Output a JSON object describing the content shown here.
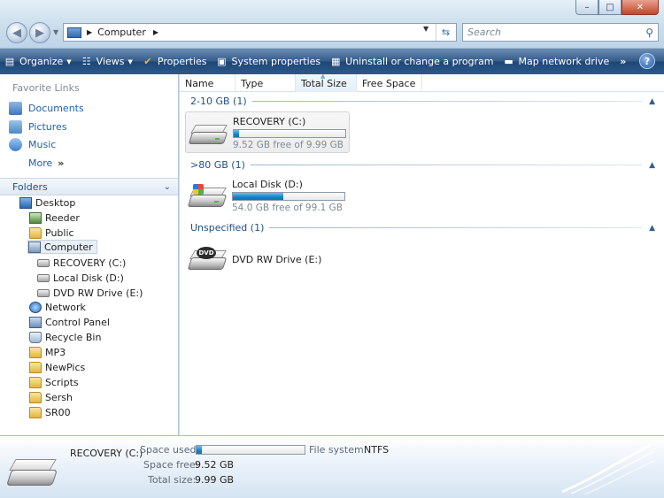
{
  "window": {
    "minimize_glyph": "–",
    "maximize_glyph": "□",
    "close_glyph": "✕"
  },
  "address": {
    "path": "Computer",
    "search_placeholder": "Search"
  },
  "commands": [
    {
      "label": "Organize",
      "icon": "organize-icon",
      "has_caret": true
    },
    {
      "label": "Views",
      "icon": "views-icon",
      "has_caret": true
    },
    {
      "label": "Properties",
      "icon": "checkmark-icon",
      "has_caret": false
    },
    {
      "label": "System properties",
      "icon": "system-properties-icon",
      "has_caret": false
    },
    {
      "label": "Uninstall or change a program",
      "icon": "uninstall-icon",
      "has_caret": false
    },
    {
      "label": "Map network drive",
      "icon": "network-drive-icon",
      "has_caret": false
    }
  ],
  "help_label": "?",
  "nav": {
    "favorites_header": "Favorite Links",
    "favorites": [
      "Documents",
      "Pictures",
      "Music"
    ],
    "more": "More",
    "folders_header": "Folders",
    "tree": [
      {
        "label": "Desktop",
        "icon": "desktop-icon",
        "level": 0
      },
      {
        "label": "Reeder",
        "icon": "user-folder-icon",
        "level": 1
      },
      {
        "label": "Public",
        "icon": "folder-icon",
        "level": 1
      },
      {
        "label": "Computer",
        "icon": "computer-icon",
        "level": 1,
        "selected": true
      },
      {
        "label": "RECOVERY (C:)",
        "icon": "drive-icon",
        "level": 2
      },
      {
        "label": "Local Disk (D:)",
        "icon": "drive-icon",
        "level": 2
      },
      {
        "label": "DVD RW Drive (E:)",
        "icon": "dvd-drive-icon",
        "level": 2
      },
      {
        "label": "Network",
        "icon": "network-icon",
        "level": 1
      },
      {
        "label": "Control Panel",
        "icon": "control-panel-icon",
        "level": 1
      },
      {
        "label": "Recycle Bin",
        "icon": "recycle-bin-icon",
        "level": 1
      },
      {
        "label": "MP3",
        "icon": "folder-icon",
        "level": 1
      },
      {
        "label": "NewPics",
        "icon": "folder-icon",
        "level": 1
      },
      {
        "label": "Scripts",
        "icon": "folder-icon",
        "level": 1
      },
      {
        "label": "Sersh",
        "icon": "folder-icon",
        "level": 1
      },
      {
        "label": "SR00",
        "icon": "folder-icon",
        "level": 1
      }
    ]
  },
  "columns": [
    "Name",
    "Type",
    "Total Size",
    "Free Space"
  ],
  "groups": [
    {
      "header": "2-10 GB (1)",
      "drive": {
        "name": "RECOVERY (C:)",
        "free_text": "9.52 GB free of 9.99 GB",
        "used_fraction": 0.047
      }
    },
    {
      "header": ">80 GB (1)",
      "drive": {
        "name": "Local Disk (D:)",
        "free_text": "54.0 GB free of 99.1 GB",
        "used_fraction": 0.455
      }
    },
    {
      "header": "Unspecified (1)",
      "drive": {
        "name": "DVD RW Drive (E:)",
        "badge": "DVD"
      }
    }
  ],
  "details": {
    "name": "RECOVERY (C:)",
    "space_used_label": "Space used:",
    "used_fraction": 0.047,
    "file_system_label": "File system:",
    "file_system": "NTFS",
    "space_free_label": "Space free:",
    "space_free": "9.52 GB",
    "total_size_label": "Total size:",
    "total_size": "9.99 GB"
  },
  "colors": {
    "command_bar": "#2b5a8c",
    "link_blue": "#1f5fb0",
    "progress_fill": "#1a84c9"
  }
}
